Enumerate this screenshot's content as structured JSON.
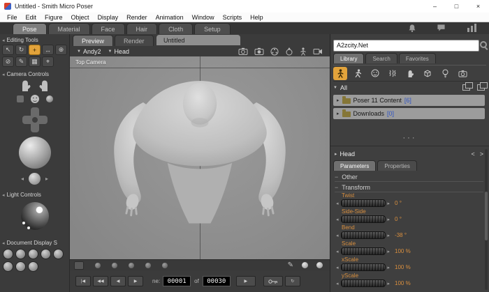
{
  "colors": {
    "accent_orange": "#e2a33b",
    "dial_text": "#d98f3f",
    "count_blue": "#2f54c4",
    "selection_gray": "#9c9c9c"
  },
  "icons": {
    "dropdown": "▼",
    "collapse_left": "◂",
    "tree_arrow": "▸",
    "dial_left": "◂",
    "dial_right": "▸",
    "section_minus": "−",
    "loop": "↻",
    "play": "▶",
    "pencil": "✎"
  },
  "window": {
    "title": "Untitled - Smith Micro Poser",
    "minimize": "–",
    "maximize": "□",
    "close": "×"
  },
  "menu": {
    "items": [
      "File",
      "Edit",
      "Figure",
      "Object",
      "Display",
      "Render",
      "Animation",
      "Window",
      "Scripts",
      "Help"
    ]
  },
  "rooms": {
    "tabs": [
      "Pose",
      "Material",
      "Face",
      "Hair",
      "Cloth",
      "Setup"
    ]
  },
  "left_panel": {
    "editing_tools_label": "Editing Tools",
    "tools": [
      "↖",
      "↻",
      "+",
      "↔",
      "⊕",
      "⊘",
      "✎",
      "▦",
      "⌖"
    ],
    "camera_controls_label": "Camera Controls",
    "light_controls_label": "Light Controls",
    "document_display_label": "Document Display S"
  },
  "center": {
    "view_tabs": [
      "Preview",
      "Render"
    ],
    "doc_tab": "Untitled",
    "figure_menu": "Andy2",
    "actor_menu": "Head",
    "camera_label": "Top Camera"
  },
  "playback": {
    "transport": [
      "|◀",
      "◀◀",
      "◀",
      "▶"
    ],
    "frame_prefix": "ne:",
    "current": "00001",
    "of_label": "of",
    "total": "00030"
  },
  "library": {
    "search_value": "A2zcity.Net",
    "tabs": [
      "Library",
      "Search",
      "Favorites"
    ],
    "all_label": "All",
    "items": [
      {
        "label": "Poser 11 Content",
        "count": "[6]"
      },
      {
        "label": "Downloads",
        "count": "[0]"
      }
    ],
    "splitter": "···"
  },
  "parameters": {
    "actor_label": "Head",
    "prev": "<",
    "next": ">",
    "tabs": [
      "Parameters",
      "Properties"
    ],
    "sections": [
      "Other",
      "Transform"
    ],
    "dials": [
      {
        "name": "Twist",
        "value": "0 °"
      },
      {
        "name": "Side-Side",
        "value": "0 °"
      },
      {
        "name": "Bend",
        "value": "-38 °"
      },
      {
        "name": "Scale",
        "value": "100 %"
      },
      {
        "name": "xScale",
        "value": "100 %"
      },
      {
        "name": "yScale",
        "value": "100 %"
      }
    ]
  }
}
